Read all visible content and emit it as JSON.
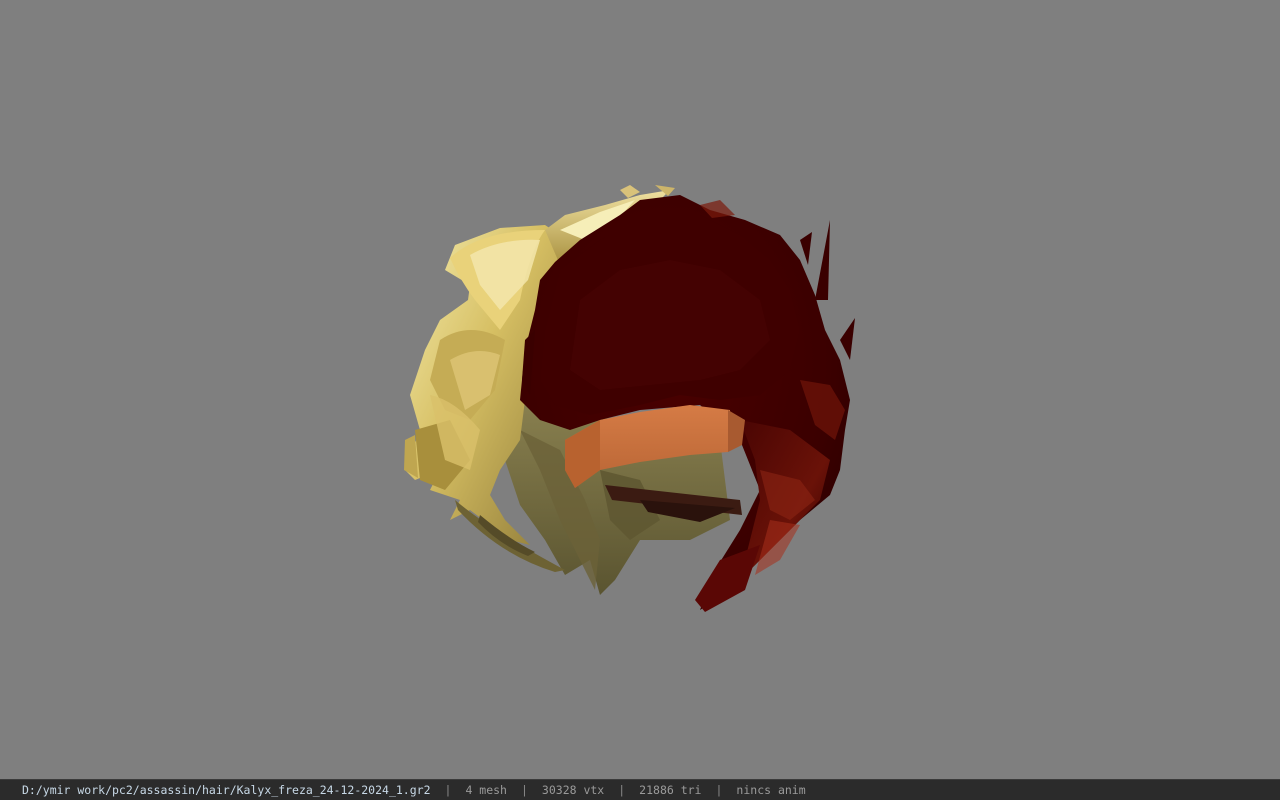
{
  "viewport": {
    "background": "#7f7f7f",
    "model": {
      "name": "hair-mesh-preview",
      "colors": {
        "blonde_light": "#f2e5a0",
        "blonde_mid": "#c9b15a",
        "blonde_dark": "#8a7434",
        "olive": "#7d7446",
        "olive_dark": "#4d4a2c",
        "dark_red": "#3f0000",
        "dark_red_mid": "#5a0705",
        "red_highlight": "#a8301c",
        "headband": "#c8713f",
        "headband_shade": "#a85a30",
        "strap": "#3a1a12"
      }
    }
  },
  "statusbar": {
    "file_path": "D:/ymir work/pc2/assassin/hair/Kalyx_freza_24-12-2024_1.gr2",
    "separator": "|",
    "mesh_count": "4 mesh",
    "vertex_count": "30328 vtx",
    "triangle_count": "21886 tri",
    "anim_status": "nincs anim"
  }
}
